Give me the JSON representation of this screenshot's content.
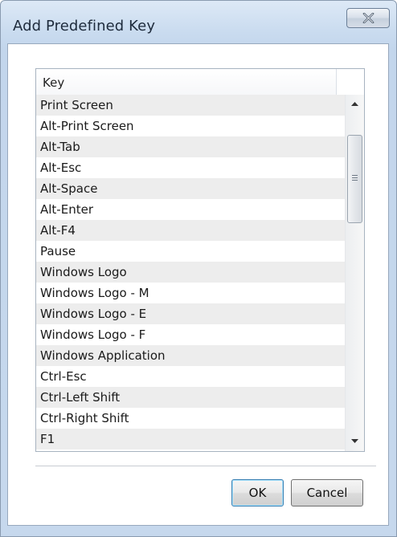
{
  "window": {
    "title": "Add Predefined Key"
  },
  "titlebar": {
    "close_icon": "close-x-icon"
  },
  "list": {
    "column_header": "Key",
    "items": [
      "Print Screen",
      "Alt-Print Screen",
      "Alt-Tab",
      "Alt-Esc",
      "Alt-Space",
      "Alt-Enter",
      "Alt-F4",
      "Pause",
      "Windows Logo",
      "Windows Logo - M",
      "Windows Logo - E",
      "Windows Logo - F",
      "Windows Application",
      "Ctrl-Esc",
      "Ctrl-Left Shift",
      "Ctrl-Right Shift",
      "F1"
    ]
  },
  "buttons": {
    "ok_label": "OK",
    "cancel_label": "Cancel"
  }
}
